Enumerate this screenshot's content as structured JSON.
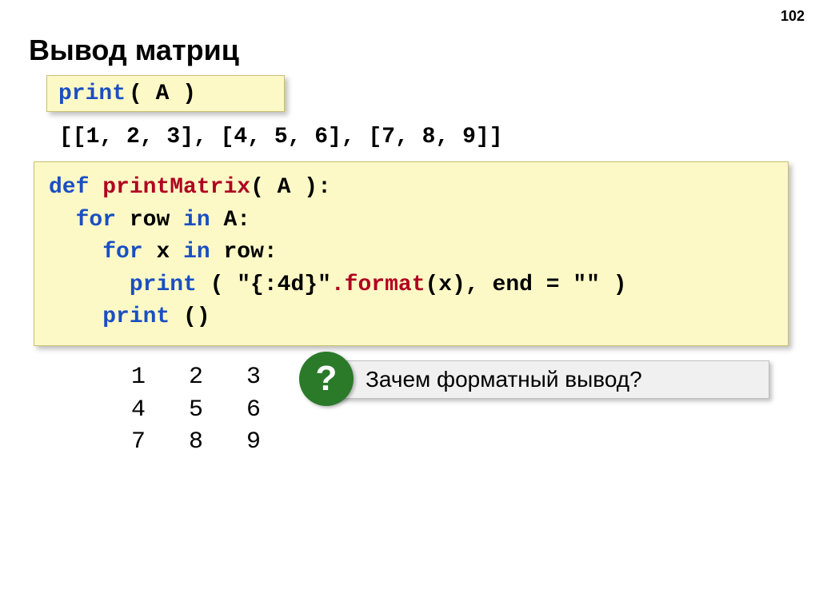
{
  "page_number": "102",
  "title": "Вывод матриц",
  "code1": {
    "print_kw": "print",
    "rest": " ( A )"
  },
  "output_line": "[[1, 2, 3], [4, 5, 6], [7, 8, 9]]",
  "code2": {
    "l1_def": "def",
    "l1_name": " printMatrix",
    "l1_rest": "( A ):",
    "l2_indent": "  ",
    "l2_for": "for",
    "l2_mid": " row ",
    "l2_in": "in",
    "l2_rest": " A:",
    "l3_indent": "    ",
    "l3_for": "for",
    "l3_mid": " x ",
    "l3_in": "in",
    "l3_rest": " row:",
    "l4_indent": "      ",
    "l4_print": "print",
    "l4_rest1": " ( \"{:4d}\"",
    "l4_format": ".format",
    "l4_rest2": "(x), end = \"\" )",
    "l5_indent": "    ",
    "l5_print": "print",
    "l5_rest": " ()"
  },
  "matrix_output": "   1   2   3\n   4   5   6\n   7   8   9",
  "question": {
    "mark": "?",
    "text": "Зачем форматный вывод?"
  }
}
